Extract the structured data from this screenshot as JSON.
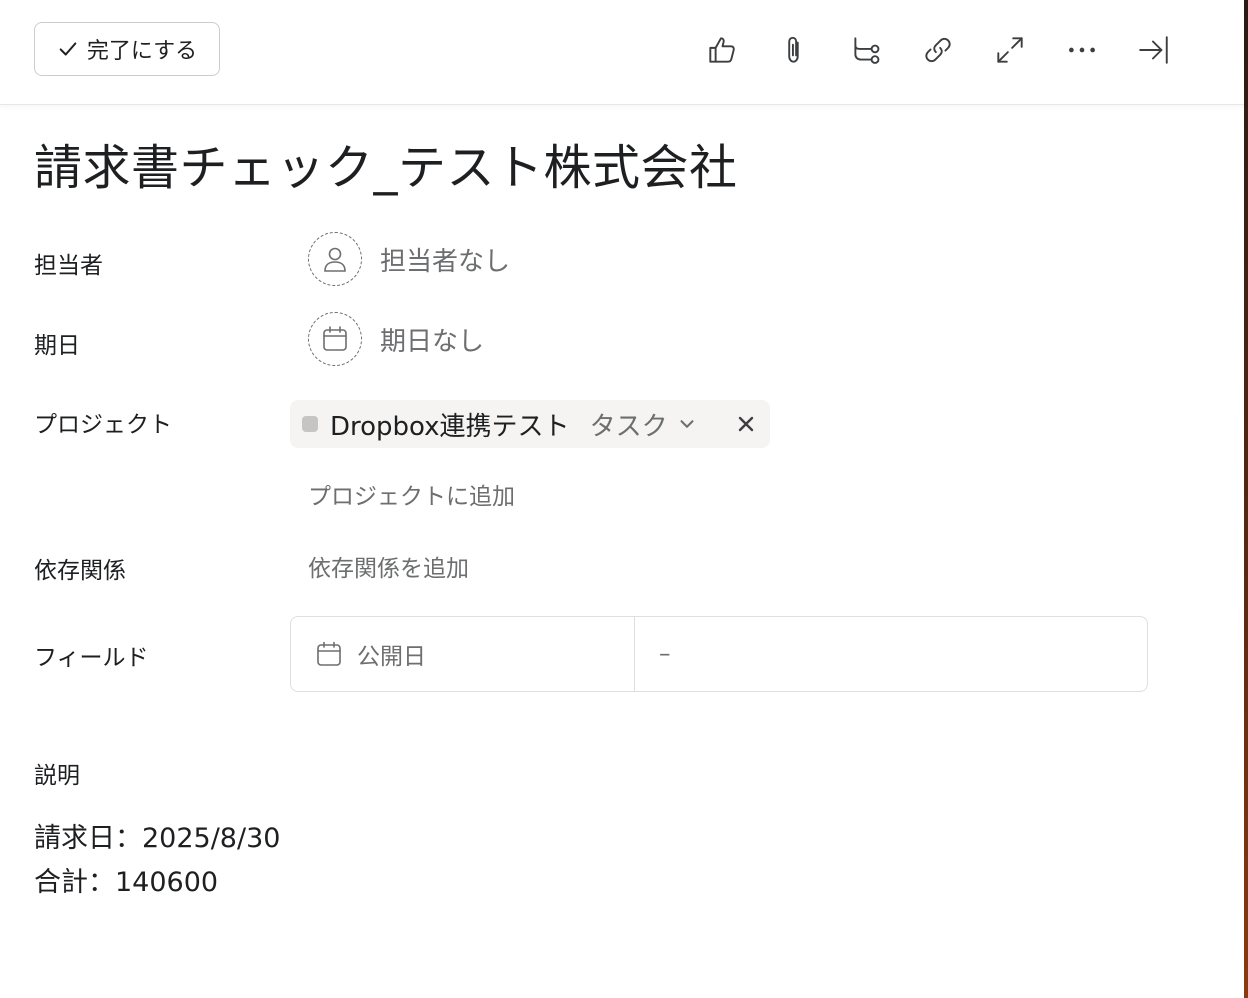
{
  "toolbar": {
    "complete_label": "完了にする",
    "icons": [
      "like-icon",
      "attachment-icon",
      "subtask-icon",
      "link-icon",
      "expand-icon",
      "more-icon",
      "close-pane-icon"
    ]
  },
  "task": {
    "title": "請求書チェック_テスト株式会社"
  },
  "fields": {
    "assignee": {
      "label": "担当者",
      "value": "担当者なし"
    },
    "due_date": {
      "label": "期日",
      "value": "期日なし"
    },
    "projects": {
      "label": "プロジェクト",
      "items": [
        {
          "name": "Dropbox連携テスト",
          "section": "タスク"
        }
      ],
      "add_label": "プロジェクトに追加"
    },
    "dependencies": {
      "label": "依存関係",
      "add_label": "依存関係を追加"
    },
    "custom_fields": {
      "label": "フィールド",
      "rows": [
        {
          "name": "公開日",
          "value": "–"
        }
      ]
    }
  },
  "description": {
    "label": "説明",
    "lines": [
      "請求日：2025/8/30",
      "合計：140600"
    ]
  },
  "colors": {
    "text": "#1e1f21",
    "muted": "#6d6e6f",
    "chip_bg": "#f5f4f3",
    "border": "#e0dfdf"
  }
}
